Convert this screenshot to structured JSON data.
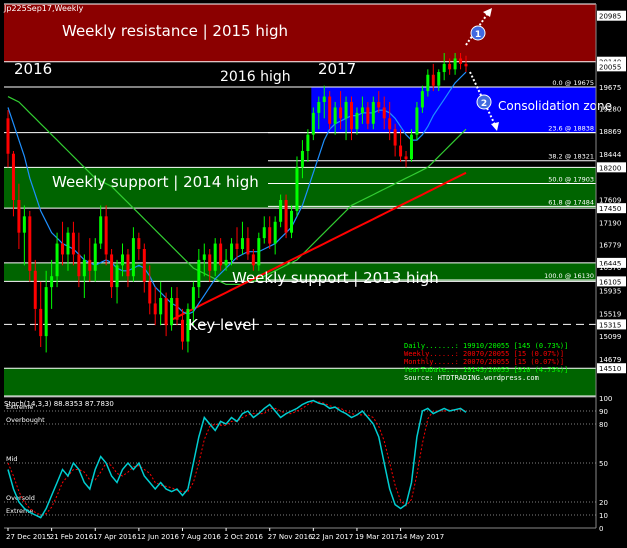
{
  "title": "Jp225Sep17,Weekly",
  "colors": {
    "background": "#000000",
    "resistance_zone": "#8B0000",
    "support_zone": "#006400",
    "consolidation_zone": "#0000FF",
    "candle_up": "#00FF00",
    "candle_down": "#FF0000",
    "ma_fast": "#1E90FF",
    "ma_mid": "#32CD32",
    "ma_slow": "#FF0000",
    "stoch_main": "#00CED1",
    "stoch_signal": "#FF0000",
    "grid_line": "#FFFFFF",
    "info_green": "#00FF00",
    "info_red": "#FF0000"
  },
  "annotations": {
    "resistance": "Weekly resistance | 2015 high",
    "label_2016": "2016",
    "label_2016_high": "2016 high",
    "label_2017": "2017",
    "consolidation": "Consolidation zone",
    "support_2014": "Weekly support | 2014 high",
    "support_2013": "Weekly support | 2013 high",
    "key_level": "Key level",
    "marker_1": "1",
    "marker_2": "2"
  },
  "fib_labels": [
    {
      "text": "0.0 @ 19675",
      "value": 19675
    },
    {
      "text": "23.6 @ 18838",
      "value": 18838
    },
    {
      "text": "38.2 @ 18321",
      "value": 18321
    },
    {
      "text": "50.0 @ 17903",
      "value": 17903
    },
    {
      "text": "61.8 @ 17484",
      "value": 17484
    },
    {
      "text": "100.0 @ 16130",
      "value": 16130
    }
  ],
  "info_box": [
    {
      "text": "Daily.......: 19910/20055 [145 (0.73%)]",
      "color": "green"
    },
    {
      "text": "Weekly......: 20070/20055 [15 (0.07%)]",
      "color": "red"
    },
    {
      "text": "Monthly.....: 20070/20055 [15 (0.07%)]",
      "color": "red"
    },
    {
      "text": "YearToDate..: 19145/20055 [910 (4.75%)]",
      "color": "green"
    },
    {
      "text": "Source: HTDTRADING.wordpress.com",
      "color": "white"
    }
  ],
  "stoch": {
    "label": "Stoch(14,3,3) 88.8353 87.7830",
    "levels": [
      {
        "text": "Extreme",
        "value": 90
      },
      {
        "text": "Overbought",
        "value": 80
      },
      {
        "text": "Mid",
        "value": 50
      },
      {
        "text": "Oversold",
        "value": 20
      },
      {
        "text": "Extreme",
        "value": 10
      }
    ],
    "axis_labels": [
      "100",
      "90",
      "80",
      "50",
      "20",
      "10",
      "0"
    ]
  },
  "chart_data": {
    "type": "candlestick",
    "title": "Jp225Sep17,Weekly",
    "ylim": [
      14000,
      21200
    ],
    "price_axis_labels": [
      "20985",
      "20140",
      "20055",
      "19675",
      "19280",
      "18869",
      "18444",
      "18200",
      "17609",
      "17450",
      "17190",
      "16779",
      "16445",
      "16370",
      "16105",
      "15935",
      "15519",
      "15315",
      "15099",
      "14679",
      "14510"
    ],
    "highlighted_prices": [
      20985,
      20140,
      20055,
      18200,
      17450,
      16445,
      16105,
      15315,
      14510
    ],
    "x_labels": [
      "27 Dec 2015",
      "21 Feb 2016",
      "17 Apr 2016",
      "12 Jun 2016",
      "7 Aug 2016",
      "2 Oct 2016",
      "27 Nov 2016",
      "22 Jan 2017",
      "19 Mar 2017",
      "14 May 2017"
    ],
    "zones": [
      {
        "name": "resistance",
        "from": 20140,
        "to": 21200
      },
      {
        "name": "consolidation",
        "from": 18838,
        "to": 19675
      },
      {
        "name": "support_2014",
        "from": 17450,
        "to": 18200
      },
      {
        "name": "support_2013",
        "from": 16105,
        "to": 16445
      },
      {
        "name": "bottom_support",
        "from": 14000,
        "to": 14510
      }
    ],
    "dashed_levels": [
      19675,
      15315
    ],
    "candles": [
      {
        "o": 19100,
        "h": 19250,
        "l": 18200,
        "c": 18450
      },
      {
        "o": 18450,
        "h": 18500,
        "l": 17300,
        "c": 17600
      },
      {
        "o": 17600,
        "h": 17900,
        "l": 16700,
        "c": 17000
      },
      {
        "o": 17000,
        "h": 17500,
        "l": 16400,
        "c": 17300
      },
      {
        "o": 17300,
        "h": 17400,
        "l": 16100,
        "c": 16300
      },
      {
        "o": 16300,
        "h": 16500,
        "l": 15200,
        "c": 15600
      },
      {
        "o": 15600,
        "h": 16100,
        "l": 14900,
        "c": 15100
      },
      {
        "o": 15100,
        "h": 16300,
        "l": 14800,
        "c": 16000
      },
      {
        "o": 16000,
        "h": 16500,
        "l": 15600,
        "c": 16200
      },
      {
        "o": 16200,
        "h": 17000,
        "l": 16000,
        "c": 16800
      },
      {
        "o": 16800,
        "h": 17200,
        "l": 16400,
        "c": 16600
      },
      {
        "o": 16600,
        "h": 17100,
        "l": 16300,
        "c": 17000
      },
      {
        "o": 17000,
        "h": 17200,
        "l": 16400,
        "c": 16600
      },
      {
        "o": 16600,
        "h": 17000,
        "l": 16000,
        "c": 16200
      },
      {
        "o": 16200,
        "h": 16600,
        "l": 15800,
        "c": 16500
      },
      {
        "o": 16500,
        "h": 16900,
        "l": 16100,
        "c": 16300
      },
      {
        "o": 16300,
        "h": 16900,
        "l": 16100,
        "c": 16800
      },
      {
        "o": 16800,
        "h": 17500,
        "l": 16700,
        "c": 17300
      },
      {
        "o": 17300,
        "h": 17500,
        "l": 16400,
        "c": 16600
      },
      {
        "o": 16600,
        "h": 16700,
        "l": 15800,
        "c": 16000
      },
      {
        "o": 16000,
        "h": 16500,
        "l": 15700,
        "c": 16400
      },
      {
        "o": 16400,
        "h": 16800,
        "l": 16200,
        "c": 16600
      },
      {
        "o": 16600,
        "h": 16700,
        "l": 16000,
        "c": 16200
      },
      {
        "o": 16200,
        "h": 17100,
        "l": 16100,
        "c": 16900
      },
      {
        "o": 16900,
        "h": 17000,
        "l": 16500,
        "c": 16700
      },
      {
        "o": 16700,
        "h": 16800,
        "l": 15900,
        "c": 16100
      },
      {
        "o": 16100,
        "h": 16400,
        "l": 15500,
        "c": 15700
      },
      {
        "o": 15700,
        "h": 16000,
        "l": 15300,
        "c": 15500
      },
      {
        "o": 15500,
        "h": 16100,
        "l": 15300,
        "c": 15800
      },
      {
        "o": 15800,
        "h": 15900,
        "l": 15100,
        "c": 15300
      },
      {
        "o": 15300,
        "h": 16000,
        "l": 15200,
        "c": 15800
      },
      {
        "o": 15800,
        "h": 16000,
        "l": 15300,
        "c": 15400
      },
      {
        "o": 15400,
        "h": 15600,
        "l": 14850,
        "c": 15000
      },
      {
        "o": 15000,
        "h": 15700,
        "l": 14800,
        "c": 15600
      },
      {
        "o": 15600,
        "h": 16100,
        "l": 15300,
        "c": 16000
      },
      {
        "o": 16000,
        "h": 16700,
        "l": 15800,
        "c": 16500
      },
      {
        "o": 16500,
        "h": 16800,
        "l": 16200,
        "c": 16600
      },
      {
        "o": 16600,
        "h": 16700,
        "l": 16100,
        "c": 16300
      },
      {
        "o": 16300,
        "h": 16900,
        "l": 16200,
        "c": 16800
      },
      {
        "o": 16800,
        "h": 16900,
        "l": 16300,
        "c": 16400
      },
      {
        "o": 16400,
        "h": 16700,
        "l": 16300,
        "c": 16500
      },
      {
        "o": 16500,
        "h": 16900,
        "l": 16400,
        "c": 16800
      },
      {
        "o": 16800,
        "h": 17100,
        "l": 16500,
        "c": 16700
      },
      {
        "o": 16700,
        "h": 17200,
        "l": 16600,
        "c": 16900
      },
      {
        "o": 16900,
        "h": 17100,
        "l": 16500,
        "c": 16600
      },
      {
        "o": 16600,
        "h": 16700,
        "l": 16300,
        "c": 16400
      },
      {
        "o": 16400,
        "h": 17000,
        "l": 16300,
        "c": 16900
      },
      {
        "o": 16900,
        "h": 17300,
        "l": 16800,
        "c": 17100
      },
      {
        "o": 17100,
        "h": 17300,
        "l": 16700,
        "c": 16800
      },
      {
        "o": 16800,
        "h": 17300,
        "l": 16600,
        "c": 17200
      },
      {
        "o": 17200,
        "h": 17700,
        "l": 17100,
        "c": 17600
      },
      {
        "o": 17600,
        "h": 17700,
        "l": 16900,
        "c": 17000
      },
      {
        "o": 17000,
        "h": 17500,
        "l": 16900,
        "c": 17400
      },
      {
        "o": 17400,
        "h": 18400,
        "l": 17300,
        "c": 18200
      },
      {
        "o": 18200,
        "h": 18700,
        "l": 18000,
        "c": 18500
      },
      {
        "o": 18500,
        "h": 18900,
        "l": 18300,
        "c": 18800
      },
      {
        "o": 18800,
        "h": 19300,
        "l": 18700,
        "c": 19200
      },
      {
        "o": 19200,
        "h": 19500,
        "l": 18900,
        "c": 19400
      },
      {
        "o": 19400,
        "h": 19700,
        "l": 19100,
        "c": 19500
      },
      {
        "o": 19500,
        "h": 19600,
        "l": 18900,
        "c": 19000
      },
      {
        "o": 19000,
        "h": 19400,
        "l": 18800,
        "c": 19300
      },
      {
        "o": 19300,
        "h": 19600,
        "l": 18900,
        "c": 19100
      },
      {
        "o": 19100,
        "h": 19500,
        "l": 18700,
        "c": 19400
      },
      {
        "o": 19400,
        "h": 19500,
        "l": 18700,
        "c": 18900
      },
      {
        "o": 18900,
        "h": 19300,
        "l": 18800,
        "c": 19200
      },
      {
        "o": 19200,
        "h": 19500,
        "l": 19000,
        "c": 19300
      },
      {
        "o": 19300,
        "h": 19400,
        "l": 18900,
        "c": 19000
      },
      {
        "o": 19000,
        "h": 19500,
        "l": 18900,
        "c": 19400
      },
      {
        "o": 19400,
        "h": 19600,
        "l": 19200,
        "c": 19300
      },
      {
        "o": 19300,
        "h": 19500,
        "l": 18900,
        "c": 19100
      },
      {
        "o": 19100,
        "h": 19400,
        "l": 18700,
        "c": 18900
      },
      {
        "o": 18900,
        "h": 19000,
        "l": 18400,
        "c": 18600
      },
      {
        "o": 18600,
        "h": 18900,
        "l": 18300,
        "c": 18400
      },
      {
        "o": 18400,
        "h": 18500,
        "l": 18200,
        "c": 18350
      },
      {
        "o": 18350,
        "h": 18900,
        "l": 18300,
        "c": 18800
      },
      {
        "o": 18800,
        "h": 19400,
        "l": 18700,
        "c": 19300
      },
      {
        "o": 19300,
        "h": 19700,
        "l": 19200,
        "c": 19600
      },
      {
        "o": 19600,
        "h": 20000,
        "l": 19500,
        "c": 19900
      },
      {
        "o": 19900,
        "h": 20100,
        "l": 19600,
        "c": 19700
      },
      {
        "o": 19700,
        "h": 20000,
        "l": 19600,
        "c": 19950
      },
      {
        "o": 19950,
        "h": 20300,
        "l": 19800,
        "c": 20100
      },
      {
        "o": 20100,
        "h": 20200,
        "l": 19900,
        "c": 20000
      },
      {
        "o": 20000,
        "h": 20300,
        "l": 19900,
        "c": 20200
      },
      {
        "o": 20200,
        "h": 20300,
        "l": 20000,
        "c": 20100
      },
      {
        "o": 20100,
        "h": 20250,
        "l": 19950,
        "c": 20055
      }
    ],
    "ma_fast": [
      19300,
      19000,
      18700,
      18400,
      18000,
      17700,
      17400,
      17200,
      17000,
      16900,
      16800,
      16750,
      16700,
      16600,
      16500,
      16450,
      16400,
      16450,
      16500,
      16450,
      16350,
      16300,
      16300,
      16350,
      16400,
      16350,
      16200,
      16000,
      15900,
      15800,
      15700,
      15650,
      15550,
      15500,
      15550,
      15700,
      15850,
      16000,
      16150,
      16250,
      16350,
      16450,
      16550,
      16600,
      16650,
      16650,
      16650,
      16700,
      16750,
      16800,
      16900,
      17000,
      17100,
      17300,
      17500,
      17800,
      18100,
      18400,
      18700,
      18900,
      19000,
      19050,
      19100,
      19150,
      19150,
      19200,
      19200,
      19200,
      19250,
      19250,
      19200,
      19100,
      18950,
      18800,
      18700,
      18700,
      18800,
      18950,
      19150,
      19300,
      19450,
      19600,
      19750,
      19850,
      19950
    ],
    "ma_mid": [
      19500,
      19450,
      19400,
      19300,
      19200,
      19100,
      19000,
      18900,
      18800,
      18700,
      18600,
      18500,
      18400,
      18300,
      18200,
      18100,
      18000,
      17950,
      17900,
      17850,
      17750,
      17650,
      17550,
      17450,
      17350,
      17250,
      17150,
      17050,
      16950,
      16850,
      16750,
      16650,
      16550,
      16450,
      16350,
      16300,
      16250,
      16200,
      16150,
      16100,
      16050,
      16050,
      16050,
      16050,
      16100,
      16100,
      16150,
      16200,
      16250,
      16300,
      16350,
      16400,
      16450,
      16500,
      16600,
      16700,
      16800,
      16900,
      17000,
      17100,
      17200,
      17300,
      17400,
      17500,
      17550,
      17600,
      17650,
      17700,
      17750,
      17800,
      17850,
      17900,
      17950,
      18000,
      18050,
      18100,
      18150,
      18200,
      18300,
      18400,
      18500,
      18600,
      18700,
      18800,
      18900
    ],
    "ma_slow": [
      null,
      null,
      null,
      null,
      null,
      null,
      null,
      null,
      null,
      null,
      null,
      null,
      null,
      null,
      null,
      null,
      null,
      null,
      null,
      null,
      null,
      null,
      null,
      null,
      null,
      null,
      null,
      null,
      null,
      null,
      15400,
      15450,
      15500,
      15550,
      15600,
      15650,
      15700,
      15750,
      15800,
      15850,
      15900,
      15950,
      16000,
      16050,
      16100,
      16150,
      16200,
      16250,
      16300,
      16350,
      16400,
      16450,
      16500,
      16550,
      16600,
      16650,
      16700,
      16750,
      16800,
      16850,
      16900,
      16950,
      17000,
      17050,
      17100,
      17150,
      17200,
      17250,
      17300,
      17350,
      17400,
      17450,
      17500,
      17550,
      17600,
      17650,
      17700,
      17750,
      17800,
      17850,
      17900,
      17950,
      18000,
      18050,
      18100
    ],
    "stoch_k": [
      45,
      30,
      20,
      15,
      12,
      10,
      8,
      15,
      25,
      35,
      45,
      40,
      50,
      45,
      35,
      30,
      45,
      55,
      50,
      40,
      35,
      45,
      50,
      45,
      50,
      40,
      35,
      30,
      35,
      30,
      28,
      30,
      25,
      30,
      50,
      70,
      85,
      80,
      75,
      82,
      80,
      85,
      82,
      88,
      90,
      85,
      88,
      92,
      95,
      90,
      85,
      88,
      90,
      92,
      95,
      97,
      98,
      96,
      95,
      92,
      93,
      90,
      88,
      85,
      87,
      90,
      85,
      80,
      70,
      50,
      30,
      18,
      15,
      18,
      35,
      70,
      90,
      92,
      88,
      90,
      92,
      90,
      91,
      92,
      89
    ],
    "stoch_d": [
      50,
      40,
      28,
      20,
      15,
      12,
      10,
      11,
      16,
      25,
      35,
      40,
      45,
      45,
      43,
      37,
      37,
      43,
      50,
      48,
      42,
      40,
      43,
      47,
      48,
      45,
      42,
      35,
      33,
      32,
      31,
      29,
      28,
      28,
      35,
      50,
      68,
      78,
      80,
      79,
      79,
      82,
      82,
      85,
      87,
      88,
      88,
      88,
      92,
      92,
      90,
      88,
      88,
      90,
      92,
      95,
      97,
      97,
      96,
      94,
      93,
      92,
      90,
      88,
      87,
      87,
      87,
      85,
      78,
      67,
      50,
      33,
      21,
      17,
      22,
      41,
      65,
      84,
      90,
      90,
      90,
      91,
      91,
      91,
      90
    ]
  }
}
